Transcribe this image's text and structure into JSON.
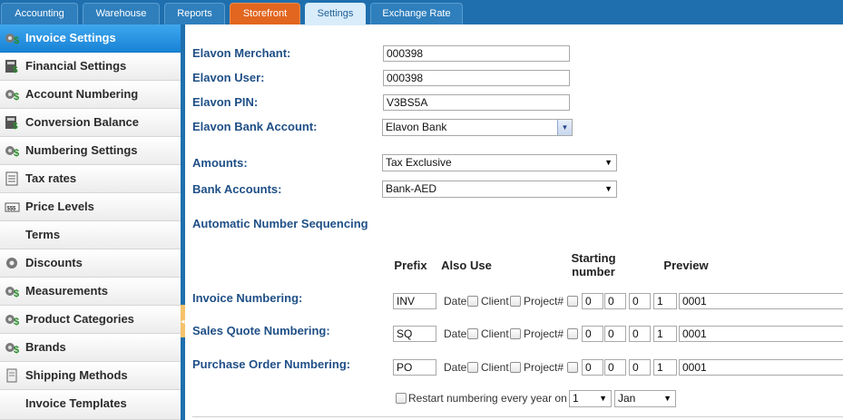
{
  "tabs": [
    {
      "label": "Accounting"
    },
    {
      "label": "Warehouse"
    },
    {
      "label": "Reports"
    },
    {
      "label": "Storefront"
    },
    {
      "label": "Settings"
    },
    {
      "label": "Exchange Rate"
    }
  ],
  "sidebar": {
    "items": [
      {
        "label": "Invoice Settings",
        "icon": "dollar-gear-icon"
      },
      {
        "label": "Financial Settings",
        "icon": "calculator-icon"
      },
      {
        "label": "Account Numbering",
        "icon": "dollar-gear-icon"
      },
      {
        "label": "Conversion Balance",
        "icon": "calculator-icon"
      },
      {
        "label": "Numbering Settings",
        "icon": "dollar-gear-icon"
      },
      {
        "label": "Tax rates",
        "icon": "list-icon"
      },
      {
        "label": "Price Levels",
        "icon": "price-tag-icon"
      },
      {
        "label": "Terms",
        "icon": ""
      },
      {
        "label": "Discounts",
        "icon": "gear-icon"
      },
      {
        "label": "Measurements",
        "icon": "dollar-gear-icon"
      },
      {
        "label": "Product Categories",
        "icon": "dollar-gear-icon"
      },
      {
        "label": "Brands",
        "icon": "dollar-gear-icon"
      },
      {
        "label": "Shipping Methods",
        "icon": "document-icon"
      },
      {
        "label": "Invoice Templates",
        "icon": ""
      }
    ]
  },
  "form": {
    "elavon_merchant_label": "Elavon Merchant:",
    "elavon_merchant_value": "000398",
    "elavon_user_label": "Elavon User:",
    "elavon_user_value": "000398",
    "elavon_pin_label": "Elavon PIN:",
    "elavon_pin_value": "V3BS5A",
    "elavon_bank_label": "Elavon Bank Account:",
    "elavon_bank_value": "Elavon Bank",
    "amounts_label": "Amounts:",
    "amounts_value": "Tax Exclusive",
    "bank_accounts_label": "Bank Accounts:",
    "bank_accounts_value": "Bank-AED"
  },
  "sequencing": {
    "title": "Automatic Number Sequencing",
    "col_prefix": "Prefix",
    "col_also_use": "Also Use",
    "col_starting_line1": "Starting",
    "col_starting_line2": "number",
    "col_preview": "Preview",
    "also_date": "Date",
    "also_client": "Client",
    "also_project": "Project#",
    "rows": [
      {
        "label": "Invoice Numbering:",
        "prefix": "INV",
        "d1": "0",
        "d2": "0",
        "d3": "0",
        "d4": "1",
        "preview": "0001"
      },
      {
        "label": "Sales Quote Numbering:",
        "prefix": "SQ",
        "d1": "0",
        "d2": "0",
        "d3": "0",
        "d4": "1",
        "preview": "0001"
      },
      {
        "label": "Purchase Order Numbering:",
        "prefix": "PO",
        "d1": "0",
        "d2": "0",
        "d3": "0",
        "d4": "1",
        "preview": "0001"
      }
    ],
    "restart_label": "Restart numbering every year on",
    "restart_day": "1",
    "restart_month": "Jan"
  }
}
